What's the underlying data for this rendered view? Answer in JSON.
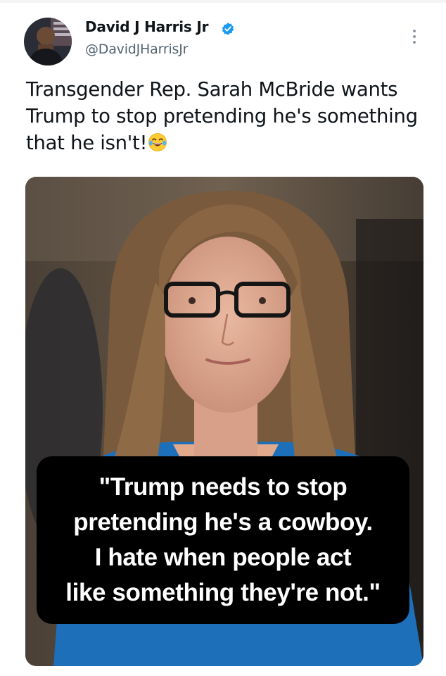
{
  "tweet": {
    "author": {
      "name": "David J Harris Jr",
      "handle": "@DavidJHarrisJr",
      "avatar_icon": "avatar-photo",
      "verified_icon": "verified-badge-icon",
      "verified_color": "#1d9bf0"
    },
    "more_icon": "more-options-icon",
    "text": "Transgender Rep. Sarah McBride wants Trump to stop pretending he's something that he isn't!",
    "emoji_icon": "laughing-crying-emoji-icon",
    "media": {
      "image": "photo-of-woman-with-glasses",
      "caption": "\"Trump needs to stop\npretending he's a cowboy.\nI hate when people act\nlike something they're not.\""
    }
  }
}
